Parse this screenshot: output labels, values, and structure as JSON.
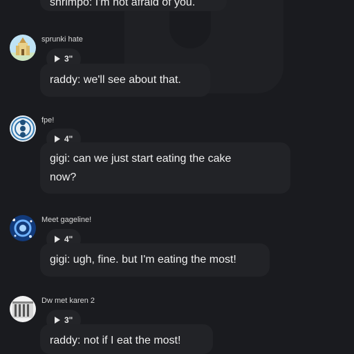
{
  "top_message": {
    "text": "shrimpo: I'm not afraid of you."
  },
  "messages": [
    {
      "username": "sprunki hate",
      "duration": "3\"",
      "text": "raddy: we'll see about that."
    },
    {
      "username": "fpe!",
      "duration": "4\"",
      "text_line1": "gigi: can we just start eating the cake",
      "text_line2": "now?"
    },
    {
      "username": "Meet gageline!",
      "duration": "4\"",
      "text": "gigi: ugh, fine. but I'm eating the most!"
    },
    {
      "username": "Dw met karen 2",
      "duration": "3\"",
      "text": "raddy: not if I eat the most!"
    }
  ],
  "colors": {
    "background": "#1a1b1f",
    "bubble": "#222327",
    "pill": "#232428",
    "text": "#f0f0f0"
  }
}
